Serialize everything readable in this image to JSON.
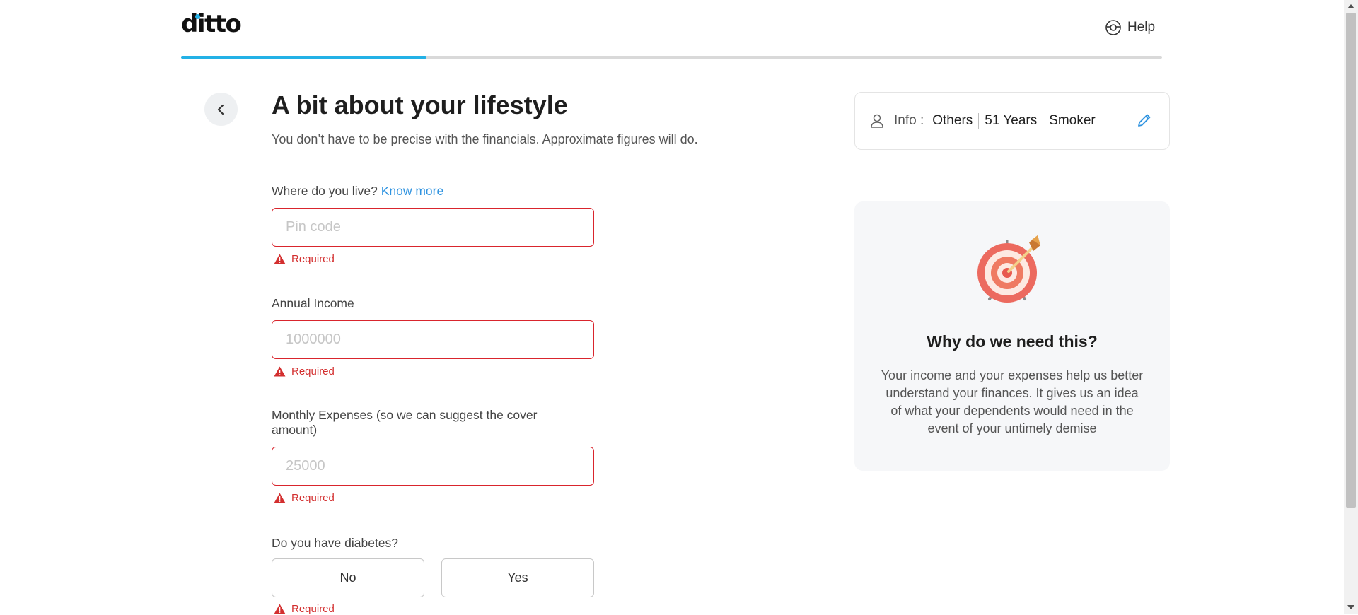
{
  "header": {
    "logo": "ditto",
    "help_label": "Help",
    "progress_fraction": 0.25
  },
  "page": {
    "title": "A bit about your lifestyle",
    "subtitle": "You don’t have to be precise with the financials. Approximate figures will do."
  },
  "form": {
    "location": {
      "label": "Where do you live?",
      "link": "Know more",
      "placeholder": "Pin code",
      "value": "",
      "error": "Required"
    },
    "income": {
      "label": "Annual Income",
      "placeholder": "1000000",
      "value": "",
      "error": "Required"
    },
    "expenses": {
      "label": "Monthly Expenses (so we can suggest the cover amount)",
      "placeholder": "25000",
      "value": "",
      "error": "Required"
    },
    "diabetes": {
      "label": "Do you have diabetes?",
      "options": [
        "No",
        "Yes"
      ],
      "error": "Required"
    }
  },
  "info": {
    "label": "Info :",
    "gender": "Others",
    "age": "51 Years",
    "smoker": "Smoker"
  },
  "why": {
    "title": "Why do we need this?",
    "text": "Your income and your expenses help us better understand your finances. It gives us an idea of what your dependents would need in the event of your untimely demise"
  },
  "colors": {
    "accent": "#23b1e6",
    "error": "#d9252d",
    "link": "#2f93e0"
  }
}
